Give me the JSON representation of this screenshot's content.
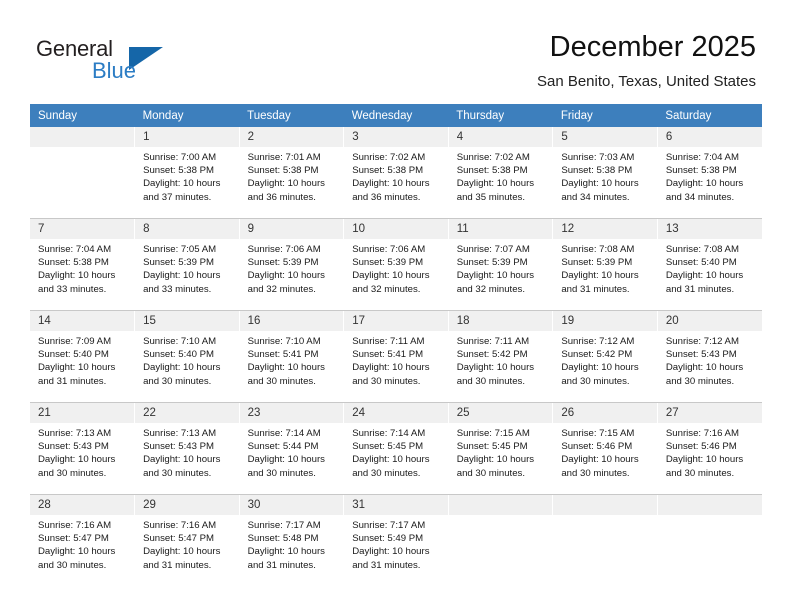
{
  "brand": {
    "name_top": "General",
    "name_bottom": "Blue",
    "accent_color": "#2b7cc4",
    "triangle_color": "#1566a8"
  },
  "header": {
    "title": "December 2025",
    "subtitle": "San Benito, Texas, United States"
  },
  "calendar": {
    "header_bg": "#3d7fbd",
    "daynum_bg": "#f0f0f0",
    "weekday_names": [
      "Sunday",
      "Monday",
      "Tuesday",
      "Wednesday",
      "Thursday",
      "Friday",
      "Saturday"
    ],
    "weeks": [
      [
        {
          "day": "",
          "lines": []
        },
        {
          "day": "1",
          "lines": [
            "Sunrise: 7:00 AM",
            "Sunset: 5:38 PM",
            "Daylight: 10 hours",
            "and 37 minutes."
          ]
        },
        {
          "day": "2",
          "lines": [
            "Sunrise: 7:01 AM",
            "Sunset: 5:38 PM",
            "Daylight: 10 hours",
            "and 36 minutes."
          ]
        },
        {
          "day": "3",
          "lines": [
            "Sunrise: 7:02 AM",
            "Sunset: 5:38 PM",
            "Daylight: 10 hours",
            "and 36 minutes."
          ]
        },
        {
          "day": "4",
          "lines": [
            "Sunrise: 7:02 AM",
            "Sunset: 5:38 PM",
            "Daylight: 10 hours",
            "and 35 minutes."
          ]
        },
        {
          "day": "5",
          "lines": [
            "Sunrise: 7:03 AM",
            "Sunset: 5:38 PM",
            "Daylight: 10 hours",
            "and 34 minutes."
          ]
        },
        {
          "day": "6",
          "lines": [
            "Sunrise: 7:04 AM",
            "Sunset: 5:38 PM",
            "Daylight: 10 hours",
            "and 34 minutes."
          ]
        }
      ],
      [
        {
          "day": "7",
          "lines": [
            "Sunrise: 7:04 AM",
            "Sunset: 5:38 PM",
            "Daylight: 10 hours",
            "and 33 minutes."
          ]
        },
        {
          "day": "8",
          "lines": [
            "Sunrise: 7:05 AM",
            "Sunset: 5:39 PM",
            "Daylight: 10 hours",
            "and 33 minutes."
          ]
        },
        {
          "day": "9",
          "lines": [
            "Sunrise: 7:06 AM",
            "Sunset: 5:39 PM",
            "Daylight: 10 hours",
            "and 32 minutes."
          ]
        },
        {
          "day": "10",
          "lines": [
            "Sunrise: 7:06 AM",
            "Sunset: 5:39 PM",
            "Daylight: 10 hours",
            "and 32 minutes."
          ]
        },
        {
          "day": "11",
          "lines": [
            "Sunrise: 7:07 AM",
            "Sunset: 5:39 PM",
            "Daylight: 10 hours",
            "and 32 minutes."
          ]
        },
        {
          "day": "12",
          "lines": [
            "Sunrise: 7:08 AM",
            "Sunset: 5:39 PM",
            "Daylight: 10 hours",
            "and 31 minutes."
          ]
        },
        {
          "day": "13",
          "lines": [
            "Sunrise: 7:08 AM",
            "Sunset: 5:40 PM",
            "Daylight: 10 hours",
            "and 31 minutes."
          ]
        }
      ],
      [
        {
          "day": "14",
          "lines": [
            "Sunrise: 7:09 AM",
            "Sunset: 5:40 PM",
            "Daylight: 10 hours",
            "and 31 minutes."
          ]
        },
        {
          "day": "15",
          "lines": [
            "Sunrise: 7:10 AM",
            "Sunset: 5:40 PM",
            "Daylight: 10 hours",
            "and 30 minutes."
          ]
        },
        {
          "day": "16",
          "lines": [
            "Sunrise: 7:10 AM",
            "Sunset: 5:41 PM",
            "Daylight: 10 hours",
            "and 30 minutes."
          ]
        },
        {
          "day": "17",
          "lines": [
            "Sunrise: 7:11 AM",
            "Sunset: 5:41 PM",
            "Daylight: 10 hours",
            "and 30 minutes."
          ]
        },
        {
          "day": "18",
          "lines": [
            "Sunrise: 7:11 AM",
            "Sunset: 5:42 PM",
            "Daylight: 10 hours",
            "and 30 minutes."
          ]
        },
        {
          "day": "19",
          "lines": [
            "Sunrise: 7:12 AM",
            "Sunset: 5:42 PM",
            "Daylight: 10 hours",
            "and 30 minutes."
          ]
        },
        {
          "day": "20",
          "lines": [
            "Sunrise: 7:12 AM",
            "Sunset: 5:43 PM",
            "Daylight: 10 hours",
            "and 30 minutes."
          ]
        }
      ],
      [
        {
          "day": "21",
          "lines": [
            "Sunrise: 7:13 AM",
            "Sunset: 5:43 PM",
            "Daylight: 10 hours",
            "and 30 minutes."
          ]
        },
        {
          "day": "22",
          "lines": [
            "Sunrise: 7:13 AM",
            "Sunset: 5:43 PM",
            "Daylight: 10 hours",
            "and 30 minutes."
          ]
        },
        {
          "day": "23",
          "lines": [
            "Sunrise: 7:14 AM",
            "Sunset: 5:44 PM",
            "Daylight: 10 hours",
            "and 30 minutes."
          ]
        },
        {
          "day": "24",
          "lines": [
            "Sunrise: 7:14 AM",
            "Sunset: 5:45 PM",
            "Daylight: 10 hours",
            "and 30 minutes."
          ]
        },
        {
          "day": "25",
          "lines": [
            "Sunrise: 7:15 AM",
            "Sunset: 5:45 PM",
            "Daylight: 10 hours",
            "and 30 minutes."
          ]
        },
        {
          "day": "26",
          "lines": [
            "Sunrise: 7:15 AM",
            "Sunset: 5:46 PM",
            "Daylight: 10 hours",
            "and 30 minutes."
          ]
        },
        {
          "day": "27",
          "lines": [
            "Sunrise: 7:16 AM",
            "Sunset: 5:46 PM",
            "Daylight: 10 hours",
            "and 30 minutes."
          ]
        }
      ],
      [
        {
          "day": "28",
          "lines": [
            "Sunrise: 7:16 AM",
            "Sunset: 5:47 PM",
            "Daylight: 10 hours",
            "and 30 minutes."
          ]
        },
        {
          "day": "29",
          "lines": [
            "Sunrise: 7:16 AM",
            "Sunset: 5:47 PM",
            "Daylight: 10 hours",
            "and 31 minutes."
          ]
        },
        {
          "day": "30",
          "lines": [
            "Sunrise: 7:17 AM",
            "Sunset: 5:48 PM",
            "Daylight: 10 hours",
            "and 31 minutes."
          ]
        },
        {
          "day": "31",
          "lines": [
            "Sunrise: 7:17 AM",
            "Sunset: 5:49 PM",
            "Daylight: 10 hours",
            "and 31 minutes."
          ]
        },
        {
          "day": "",
          "lines": []
        },
        {
          "day": "",
          "lines": []
        },
        {
          "day": "",
          "lines": []
        }
      ]
    ]
  }
}
